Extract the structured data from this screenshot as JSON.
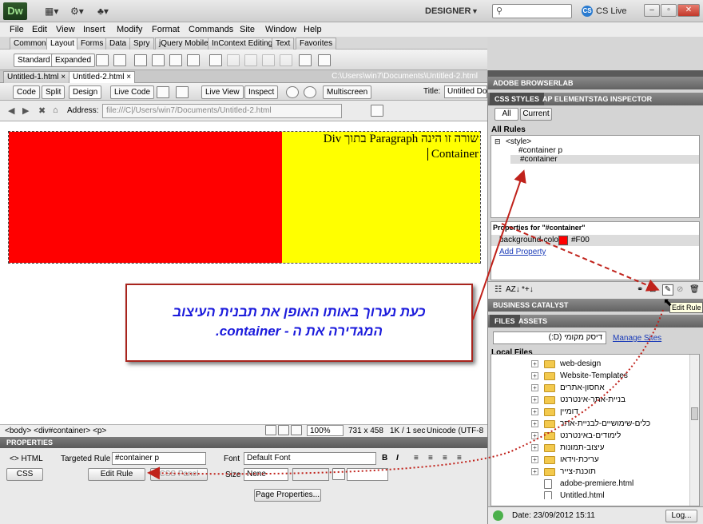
{
  "app": {
    "logo": "Dw",
    "workspace": "DESIGNER",
    "cslive": "CS Live"
  },
  "menu": [
    "File",
    "Edit",
    "View",
    "Insert",
    "Modify",
    "Format",
    "Commands",
    "Site",
    "Window",
    "Help"
  ],
  "insert_tabs": [
    "Common",
    "Layout",
    "Forms",
    "Data",
    "Spry",
    "jQuery Mobile",
    "InContext Editing",
    "Text",
    "Favorites"
  ],
  "layout_toolbar": {
    "standard": "Standard",
    "expanded": "Expanded"
  },
  "doc_tabs": [
    "Untitled-1.html",
    "Untitled-2.html"
  ],
  "doc_path": "C:\\Users\\win7\\Documents\\Untitled-2.html",
  "doc_toolbar": {
    "code": "Code",
    "split": "Split",
    "design": "Design",
    "live_code": "Live Code",
    "live_view": "Live View",
    "inspect": "Inspect",
    "multiscreen": "Multiscreen",
    "title_label": "Title:",
    "title_value": "Untitled Docu"
  },
  "address": {
    "label": "Address:",
    "value": "file:///C|/Users/win7/Documents/Untitled-2.html"
  },
  "design": {
    "line1": "שורה זו הינה Paragraph בתוך Div",
    "line2": "Container"
  },
  "callout": {
    "line1": "כעת נערוך באותו האופן את תבנית העיצוב",
    "line2": "המגדירה את ה - container."
  },
  "status": {
    "tags": "<body> <div#container> <p>",
    "zoom": "100%",
    "size": "731 x 458",
    "speed": "1K / 1 sec",
    "encoding": "Unicode (UTF-8"
  },
  "properties": {
    "title": "PROPERTIES",
    "html": "HTML",
    "css": "CSS",
    "targeted_rule_label": "Targeted Rule",
    "targeted_rule": "#container p",
    "edit_rule": "Edit Rule",
    "css_panel": "CSS Panel",
    "font_label": "Font",
    "font_value": "Default Font",
    "size_label": "Size",
    "size_value": "None",
    "page_props": "Page Properties..."
  },
  "right": {
    "browserlab": "ADOBE BROWSERLAB",
    "css_tabs": [
      "CSS STYLES",
      "AP ELEMENTS",
      "TAG INSPECTOR"
    ],
    "all": "All",
    "current": "Current",
    "all_rules": "All Rules",
    "rules": [
      "<style>",
      "#container p",
      "#container"
    ],
    "props_for": "Properties for \"#container\"",
    "prop_name": "background-color",
    "prop_value": "#F00",
    "add_property": "Add Property",
    "business": "BUSINESS CATALYST",
    "file_tabs": [
      "FILES",
      "ASSETS"
    ],
    "site": "דיסק מקומי (D:)",
    "manage": "Manage Sites",
    "local_files": "Local Files",
    "files": [
      "web-design",
      "Website-Templates",
      "אחסון-אתרים",
      "בניית-אתר-אינטרנט",
      "דומיין",
      "כלים-שימושיים-לבניית-אתר",
      "לימודים-באינטרנט",
      "עיצוב-תמונות",
      "עריכת-וידאו",
      "תוכנת-צייר",
      "adobe-premiere.html",
      "Untitled.html"
    ],
    "date": "Date: 23/09/2012 15:11",
    "log": "Log...",
    "tooltip": "Edit Rule"
  },
  "colors": {
    "red": "#ff0000",
    "yellow": "#ffff00",
    "accent": "#a8241d",
    "callout_text": "#1b1bdc"
  }
}
